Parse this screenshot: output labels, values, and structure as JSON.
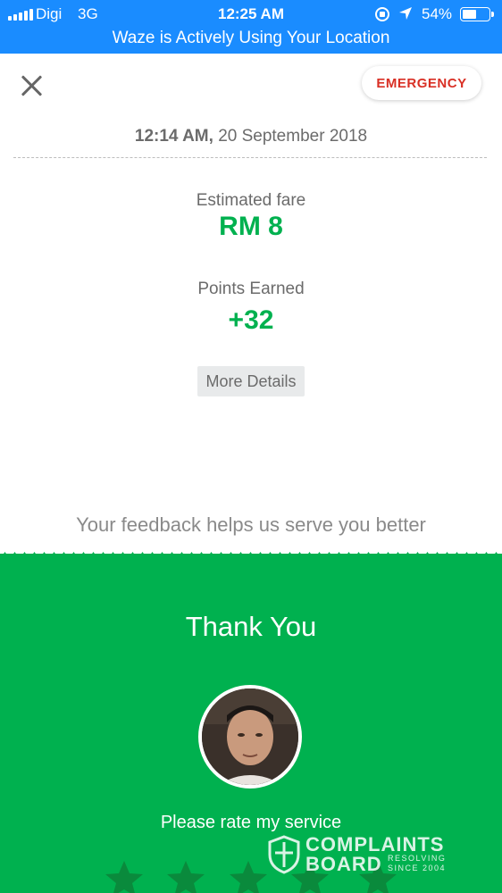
{
  "status_bar": {
    "carrier": "Digi",
    "network": "3G",
    "time": "12:25 AM",
    "battery_percent": "54%",
    "battery_level": 0.54,
    "banner": "Waze is Actively Using Your Location",
    "color": "#1a8cff"
  },
  "header": {
    "close_icon": "close-icon",
    "emergency_label": "EMERGENCY"
  },
  "trip": {
    "time": "12:14 AM,",
    "date": "20 September 2018",
    "fare_label": "Estimated fare",
    "fare_value": "RM 8",
    "points_label": "Points Earned",
    "points_value": "+32",
    "more_details_label": "More Details"
  },
  "feedback": {
    "text": "Your feedback helps us serve you better",
    "thanks": "Thank You",
    "rate_prompt": "Please rate my service",
    "star_icon": "star-icon",
    "accent": "#00b14f"
  },
  "watermark": {
    "line1": "COMPLAINTS",
    "line2": "BOARD",
    "small1": "RESOLVING",
    "small2": "SINCE 2004"
  }
}
